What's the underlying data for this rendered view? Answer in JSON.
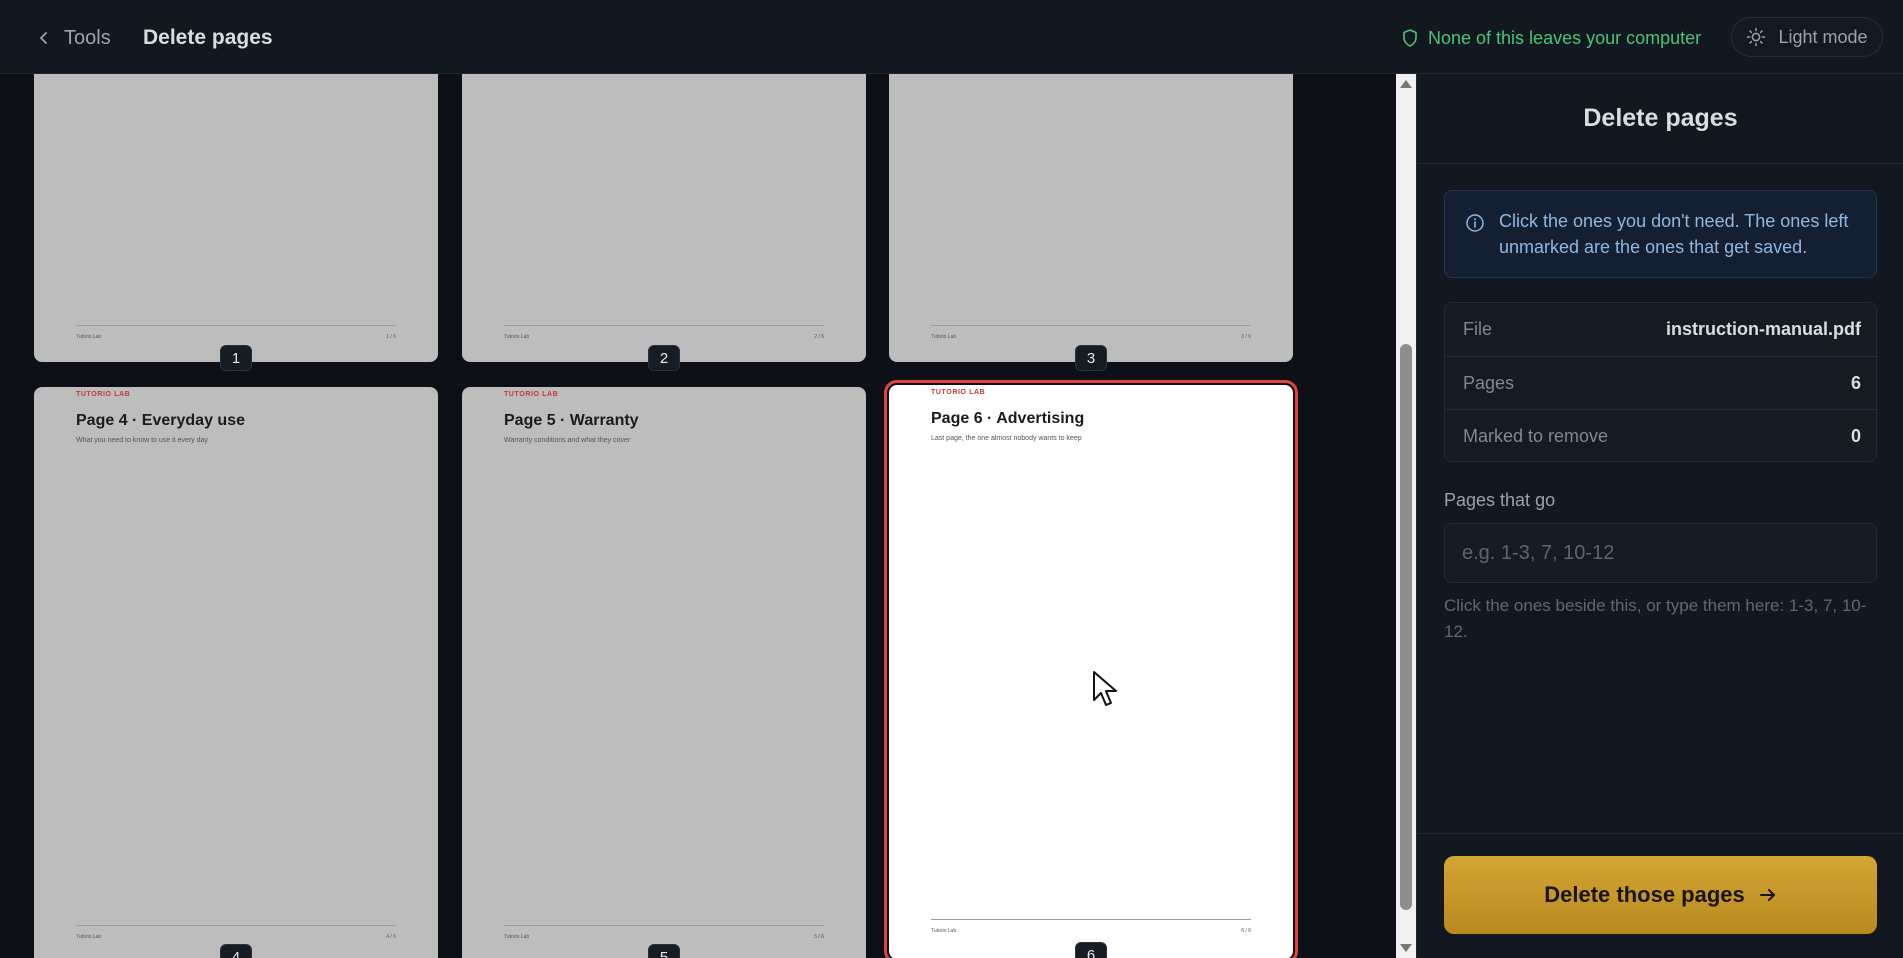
{
  "header": {
    "back_label": "Tools",
    "title": "Delete pages",
    "privacy_text": "None of this leaves your computer",
    "mode_label": "Light mode"
  },
  "pages": [
    {
      "number": "1",
      "brand": "",
      "title": "",
      "subtitle": "",
      "footer_left": "Tutorio Lab",
      "footer_right": "1 / 6",
      "selected": false
    },
    {
      "number": "2",
      "brand": "",
      "title": "",
      "subtitle": "",
      "footer_left": "Tutorio Lab",
      "footer_right": "2 / 6",
      "selected": false
    },
    {
      "number": "3",
      "brand": "",
      "title": "",
      "subtitle": "",
      "footer_left": "Tutorio Lab",
      "footer_right": "3 / 6",
      "selected": false
    },
    {
      "number": "4",
      "brand": "TUTORIO LAB",
      "title": "Page 4 · Everyday use",
      "subtitle": "What you need to know to use it every day",
      "footer_left": "Tutorio Lab",
      "footer_right": "4 / 6",
      "selected": false
    },
    {
      "number": "5",
      "brand": "TUTORIO LAB",
      "title": "Page 5 · Warranty",
      "subtitle": "Warranty conditions and what they cover",
      "footer_left": "Tutorio Lab",
      "footer_right": "5 / 6",
      "selected": false
    },
    {
      "number": "6",
      "brand": "TUTORIO LAB",
      "title": "Page 6 · Advertising",
      "subtitle": "Last page, the one almost nobody wants to keep",
      "footer_left": "Tutorio Lab",
      "footer_right": "6 / 6",
      "selected": true
    }
  ],
  "sidebar": {
    "title": "Delete pages",
    "info": "Click the ones you don't need. The ones left unmarked are the ones that get saved.",
    "stats": [
      {
        "label": "File",
        "value": "instruction-manual.pdf"
      },
      {
        "label": "Pages",
        "value": "6"
      },
      {
        "label": "Marked to remove",
        "value": "0"
      }
    ],
    "range_label": "Pages that go",
    "range_placeholder": "e.g. 1-3, 7, 10-12",
    "range_value": "",
    "hint": "Click the ones beside this, or type them here: 1-3, 7, 10-12.",
    "submit_label": "Delete those pages"
  },
  "colors": {
    "background": "#0d1117",
    "accent": "#d4a534",
    "privacy": "#4cc476",
    "selection": "#e0453b",
    "info": "#8fb7e3"
  }
}
